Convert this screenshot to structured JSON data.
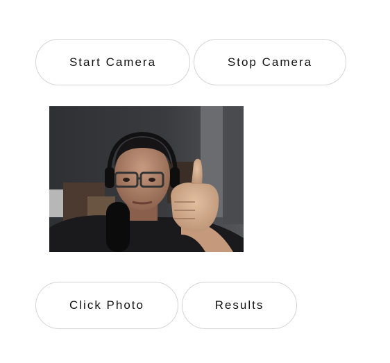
{
  "controls": {
    "start_camera_label": "Start Camera",
    "stop_camera_label": "Stop Camera",
    "click_photo_label": "Click Photo",
    "results_label": "Results"
  },
  "camera_feed": {
    "subject": "webcam preview: person with glasses and headset giving a thumbs up"
  }
}
